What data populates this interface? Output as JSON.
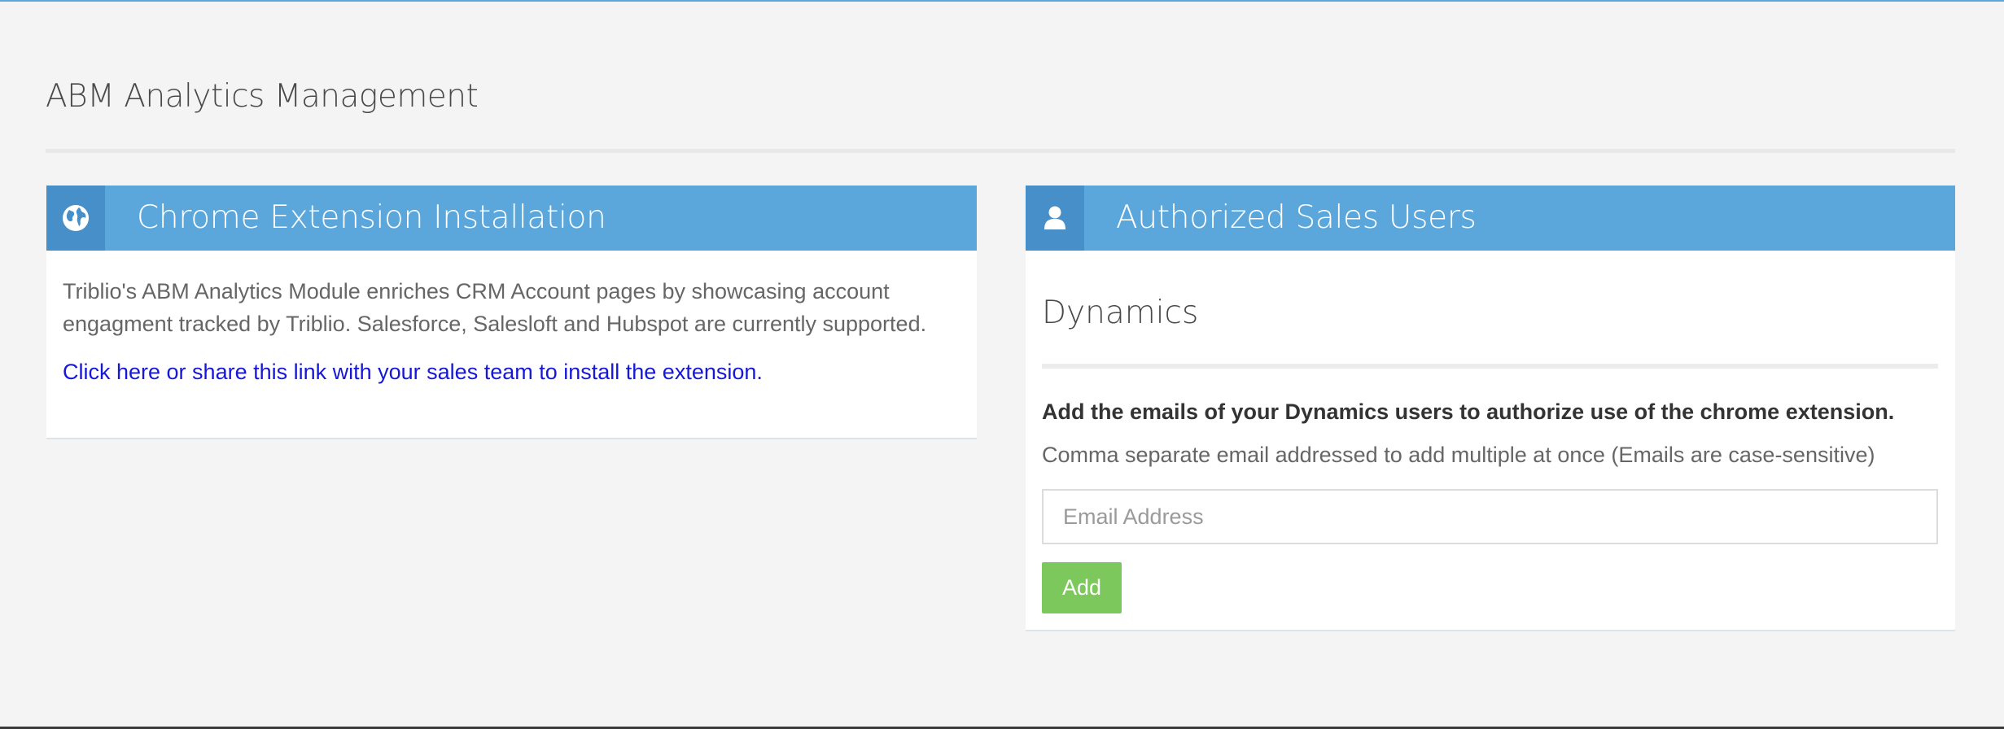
{
  "page": {
    "title": "ABM Analytics Management"
  },
  "colors": {
    "accent": "#5ba7dc",
    "accent_dark": "#468fc9",
    "button_green": "#7dc85c",
    "link": "#1717d8"
  },
  "chrome_panel": {
    "icon": "globe-icon",
    "title": "Chrome Extension Installation",
    "description": "Triblio's ABM Analytics Module enriches CRM Account pages by showcasing account engagment tracked by Triblio. Salesforce, Salesloft and Hubspot are currently supported.",
    "link_text": "Click here or share this link with your sales team to install the extension."
  },
  "users_panel": {
    "icon": "user-icon",
    "title": "Authorized Sales Users",
    "section_title": "Dynamics",
    "instruction": "Add the emails of your Dynamics users to authorize use of the chrome extension.",
    "hint": "Comma separate email addressed to add multiple at once (Emails are case-sensitive)",
    "email_placeholder": "Email Address",
    "email_value": "",
    "add_label": "Add"
  }
}
